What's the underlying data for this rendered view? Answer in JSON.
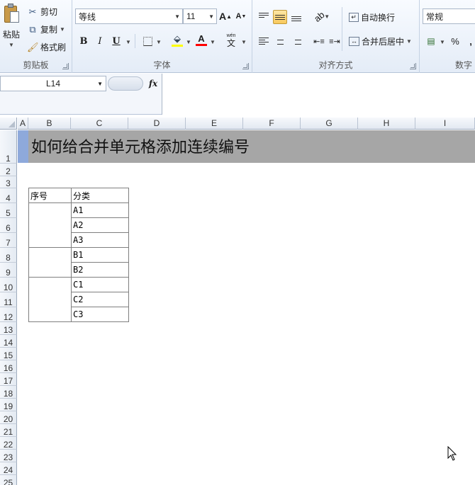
{
  "ribbon": {
    "clipboard": {
      "paste_label": "粘贴",
      "cut_label": "剪切",
      "copy_label": "复制",
      "format_painter_label": "格式刷",
      "group_label": "剪贴板"
    },
    "font": {
      "font_name": "等线",
      "font_size": "11",
      "bold": "B",
      "italic": "I",
      "underline": "U",
      "grow": "A",
      "shrink": "A",
      "color_glyph": "A",
      "phonetic_glyph": "文",
      "phonetic_top": "wén",
      "group_label": "字体"
    },
    "alignment": {
      "wrap_label": "自动换行",
      "merge_label": "合并后居中",
      "group_label": "对齐方式"
    },
    "number": {
      "format": "常规",
      "percent": "%",
      "comma": ",",
      "group_label": "数字"
    }
  },
  "formula_bar": {
    "name_box": "L14",
    "fx": "fx",
    "formula": ""
  },
  "columns": [
    "A",
    "B",
    "C",
    "D",
    "E",
    "F",
    "G",
    "H",
    "I"
  ],
  "rows": [
    "1",
    "2",
    "3",
    "4",
    "5",
    "6",
    "7",
    "8",
    "9",
    "10",
    "11",
    "12",
    "13",
    "14",
    "15",
    "16",
    "17",
    "18",
    "19",
    "20",
    "21",
    "22",
    "23",
    "24",
    "25"
  ],
  "sheet": {
    "title": "如何给合并单元格添加连续编号",
    "headers": {
      "seq": "序号",
      "category": "分类"
    },
    "categories": [
      "A1",
      "A2",
      "A3",
      "B1",
      "B2",
      "C1",
      "C2",
      "C3"
    ]
  }
}
